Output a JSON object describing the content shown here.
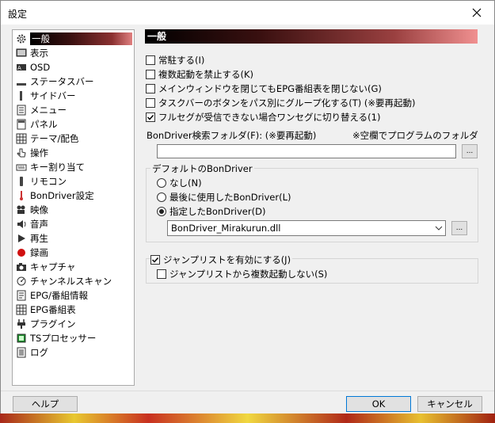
{
  "window": {
    "title": "設定"
  },
  "nav": {
    "items": [
      {
        "label": "一般",
        "icon": "gear-icon"
      },
      {
        "label": "表示",
        "icon": "monitor-icon"
      },
      {
        "label": "OSD",
        "icon": "osd-icon"
      },
      {
        "label": "ステータスバー",
        "icon": "statusbar-icon"
      },
      {
        "label": "サイドバー",
        "icon": "sidebar-icon"
      },
      {
        "label": "メニュー",
        "icon": "menu-icon"
      },
      {
        "label": "パネル",
        "icon": "panel-icon"
      },
      {
        "label": "テーマ/配色",
        "icon": "theme-icon"
      },
      {
        "label": "操作",
        "icon": "operation-icon"
      },
      {
        "label": "キー割り当て",
        "icon": "keyboard-icon"
      },
      {
        "label": "リモコン",
        "icon": "remote-icon"
      },
      {
        "label": "BonDriver設定",
        "icon": "thermometer-icon"
      },
      {
        "label": "映像",
        "icon": "film-icon"
      },
      {
        "label": "音声",
        "icon": "speaker-icon"
      },
      {
        "label": "再生",
        "icon": "play-icon"
      },
      {
        "label": "録画",
        "icon": "record-icon"
      },
      {
        "label": "キャプチャ",
        "icon": "camera-icon"
      },
      {
        "label": "チャンネルスキャン",
        "icon": "scan-icon"
      },
      {
        "label": "EPG/番組情報",
        "icon": "epg-icon"
      },
      {
        "label": "EPG番組表",
        "icon": "grid-icon"
      },
      {
        "label": "プラグイン",
        "icon": "plug-icon"
      },
      {
        "label": "TSプロセッサー",
        "icon": "chip-icon"
      },
      {
        "label": "ログ",
        "icon": "log-icon"
      }
    ]
  },
  "general": {
    "header": "一般",
    "resident": "常駐する(I)",
    "no_multi": "複数起動を禁止する(K)",
    "keep_epg": "メインウィンドウを閉じてもEPG番組表を閉じない(G)",
    "taskbar_group": "タスクバーのボタンをパス別にグループ化する(T) (※要再起動)",
    "oneseg": "フルセグが受信できない場合ワンセグに切り替える(1)",
    "bon_folder_label": "BonDriver検索フォルダ(F): (※要再起動)",
    "bon_folder_hint": "※空欄でプログラムのフォルダ",
    "bon_folder_value": "",
    "browse": "...",
    "default_bon_group": "デフォルトのBonDriver",
    "radio_none": "なし(N)",
    "radio_last": "最後に使用したBonDriver(L)",
    "radio_specified": "指定したBonDriver(D)",
    "bon_select_value": "BonDriver_Mirakurun.dll",
    "jumplist": "ジャンプリストを有効にする(J)",
    "jumplist_no_multi": "ジャンプリストから複数起動しない(S)"
  },
  "footer": {
    "help": "ヘルプ",
    "ok": "OK",
    "cancel": "キャンセル"
  }
}
